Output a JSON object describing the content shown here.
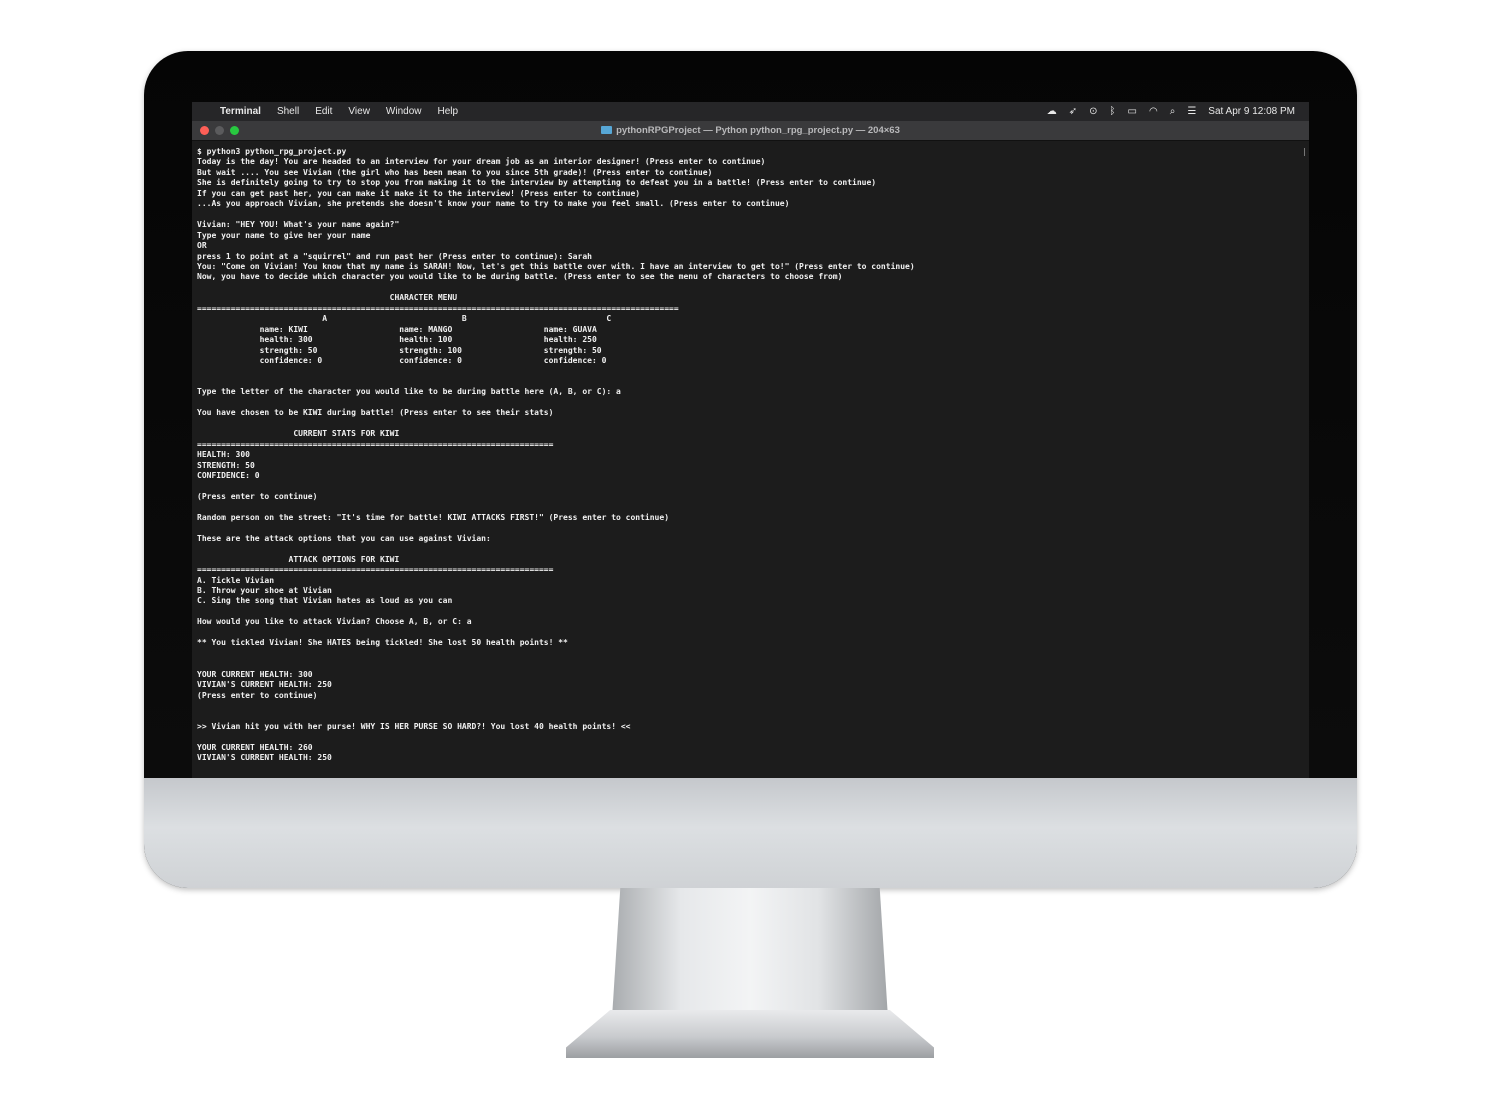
{
  "menubar": {
    "apple_glyph": "",
    "app_name": "Terminal",
    "menus": [
      "Shell",
      "Edit",
      "View",
      "Window",
      "Help"
    ],
    "status_icons": [
      "creative-cloud-icon",
      "rocket-icon",
      "play-circle-icon",
      "bluetooth-icon",
      "battery-icon",
      "wifi-icon",
      "search-icon",
      "control-center-icon"
    ],
    "clock": "Sat Apr 9  12:08 PM"
  },
  "window": {
    "title": "pythonRPGProject — Python python_rpg_project.py — 204×63"
  },
  "terminal": {
    "lines": [
      "$ python3 python_rpg_project.py",
      "Today is the day! You are headed to an interview for your dream job as an interior designer! (Press enter to continue)",
      "But wait .... You see Vivian (the girl who has been mean to you since 5th grade)! (Press enter to continue)",
      "She is definitely going to try to stop you from making it to the interview by attempting to defeat you in a battle! (Press enter to continue)",
      "If you can get past her, you can make it make it to the interview! (Press enter to continue)",
      "...As you approach Vivian, she pretends she doesn't know your name to try to make you feel small. (Press enter to continue)",
      "",
      "Vivian: \"HEY YOU! What's your name again?\"",
      "Type your name to give her your name",
      "OR",
      "press 1 to point at a \"squirrel\" and run past her (Press enter to continue): Sarah",
      "You: \"Come on Vivian! You know that my name is SARAH! Now, let's get this battle over with. I have an interview to get to!\" (Press enter to continue)",
      "Now, you have to decide which character you would like to be during battle. (Press enter to see the menu of characters to choose from)",
      "",
      "                                        CHARACTER MENU",
      "====================================================================================================",
      "                          A                            B                             C",
      "             name: KIWI                   name: MANGO                   name: GUAVA",
      "             health: 300                  health: 100                   health: 250",
      "             strength: 50                 strength: 100                 strength: 50",
      "             confidence: 0                confidence: 0                 confidence: 0",
      "",
      "",
      "Type the letter of the character you would like to be during battle here (A, B, or C): a",
      "",
      "You have chosen to be KIWI during battle! (Press enter to see their stats)",
      "",
      "                    CURRENT STATS FOR KIWI",
      "==========================================================================",
      "HEALTH: 300",
      "STRENGTH: 50",
      "CONFIDENCE: 0",
      "",
      "(Press enter to continue)",
      "",
      "Random person on the street: \"It's time for battle! KIWI ATTACKS FIRST!\" (Press enter to continue)",
      "",
      "These are the attack options that you can use against Vivian:",
      "",
      "                   ATTACK OPTIONS FOR KIWI",
      "==========================================================================",
      "A. Tickle Vivian",
      "B. Throw your shoe at Vivian",
      "C. Sing the song that Vivian hates as loud as you can",
      "",
      "How would you like to attack Vivian? Choose A, B, or C: a",
      "",
      "** You tickled Vivian! She HATES being tickled! She lost 50 health points! **",
      "",
      "",
      "YOUR CURRENT HEALTH: 300",
      "VIVIAN'S CURRENT HEALTH: 250",
      "(Press enter to continue)",
      "",
      "",
      ">> Vivian hit you with her purse! WHY IS HER PURSE SO HARD?! You lost 40 health points! <<",
      "",
      "YOUR CURRENT HEALTH: 260",
      "VIVIAN'S CURRENT HEALTH: 250"
    ]
  }
}
